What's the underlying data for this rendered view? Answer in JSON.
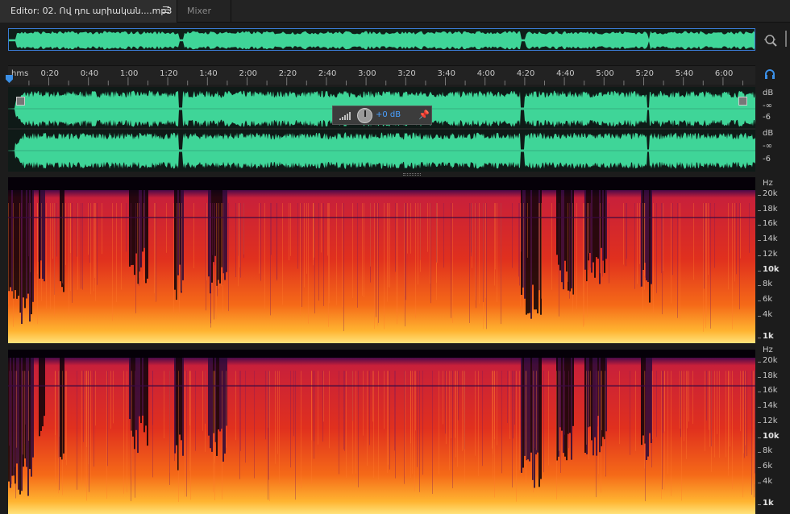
{
  "tabs": {
    "editor_label": "Editor: 02. Ով դու արիական....mp3",
    "editor_menu_icon": "hamburger-menu-icon",
    "mixer_label": "Mixer"
  },
  "ruler": {
    "unit_label": "hms",
    "ticks": [
      "0:20",
      "0:40",
      "1:00",
      "1:20",
      "1:40",
      "2:00",
      "2:20",
      "2:40",
      "3:00",
      "3:20",
      "3:40",
      "4:00",
      "4:20",
      "4:40",
      "5:00",
      "5:20",
      "5:40",
      "6:00"
    ]
  },
  "hud": {
    "volume_value": "+0 dB",
    "knob_icon": "volume-knob-icon",
    "meter_icon": "level-bars-icon",
    "pin_icon": "pin-icon"
  },
  "amplitude_scale": {
    "unit": "dB",
    "labels": [
      "-∞",
      "-6"
    ]
  },
  "spectral_scale": {
    "unit": "Hz",
    "labels": [
      "20k",
      "18k",
      "16k",
      "14k",
      "12k",
      "10k",
      "8k",
      "6k",
      "4k",
      "1k"
    ]
  },
  "colors": {
    "waveform": "#3fd598",
    "waveform_dark": "#0f1a17",
    "selection_border": "#3a7bd5",
    "accent_blue": "#4aa0ff"
  },
  "icons": {
    "zoom": "zoom-magnifier-icon",
    "headphones": "headphones-icon",
    "playhead": "playhead-marker-icon"
  }
}
